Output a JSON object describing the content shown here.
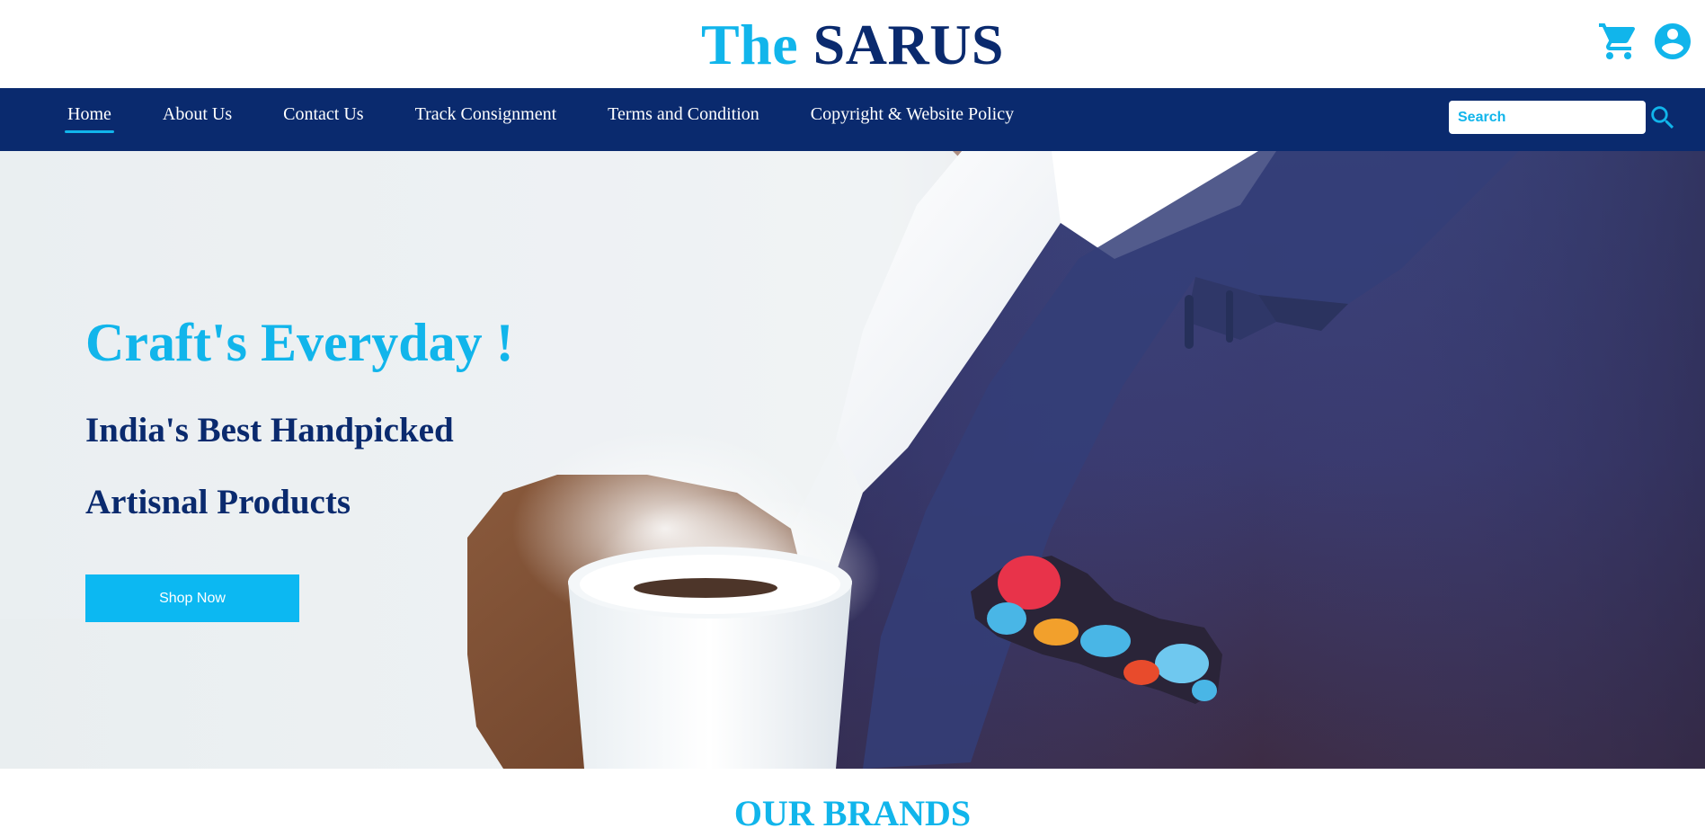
{
  "brand": {
    "logo_part1": "The",
    "logo_part2": "SARUS",
    "color_primary": "#11b5eb",
    "color_dark": "#0a2a6e"
  },
  "header": {
    "icons": [
      "cart-icon",
      "account-icon"
    ]
  },
  "nav": {
    "items": [
      {
        "label": "Home",
        "active": true
      },
      {
        "label": "About Us",
        "active": false
      },
      {
        "label": "Contact Us",
        "active": false
      },
      {
        "label": "Track Consignment",
        "active": false
      },
      {
        "label": "Terms and Condition",
        "active": false
      },
      {
        "label": "Copyright & Website Policy",
        "active": false
      }
    ],
    "search": {
      "placeholder": "Search",
      "value": "",
      "icon": "search-icon"
    }
  },
  "hero": {
    "title": "Craft's Everyday !",
    "subtitle_line1": "India's Best Handpicked",
    "subtitle_line2": "Artisnal Products",
    "cta_label": "Shop Now",
    "cta_color": "#0cb8f2"
  },
  "brands": {
    "title": "OUR BRANDS"
  }
}
